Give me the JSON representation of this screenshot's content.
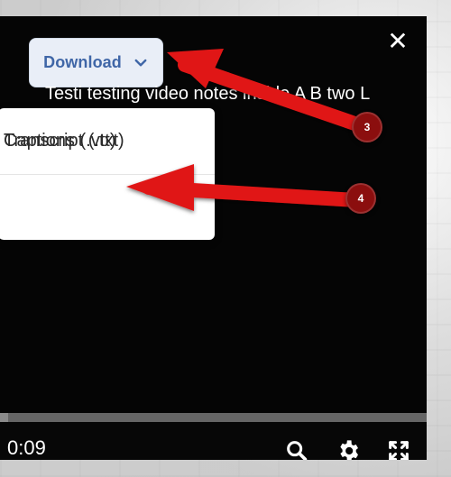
{
  "toolbar": {
    "download_label": "Download"
  },
  "captions": {
    "current_text": "Testi    testing video notes inside A B two L"
  },
  "menu": {
    "items": [
      {
        "label": "Transcript (.txt)"
      },
      {
        "label": "Captions (.vtt)"
      }
    ]
  },
  "player": {
    "time": "0:09",
    "progress_fraction": 0.02
  },
  "annotations": {
    "badge_3": "3",
    "badge_4": "4"
  },
  "colors": {
    "accent_blue": "#3f66a7",
    "annotation_red": "#e01818"
  },
  "icons": {
    "close": "close-icon",
    "chevron": "chevron-down-icon",
    "search": "search-icon",
    "settings": "gear-icon",
    "fullscreen": "fullscreen-icon"
  }
}
